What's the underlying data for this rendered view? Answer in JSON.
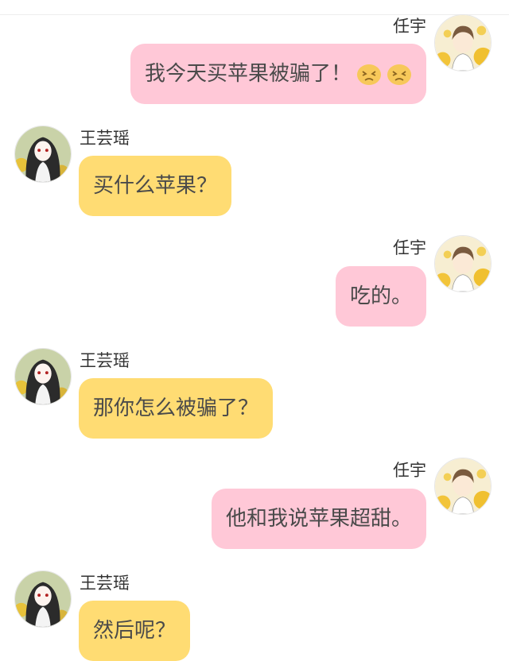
{
  "conversation": {
    "messages": [
      {
        "side": "right",
        "sender": "任宇",
        "text": "我今天买苹果被骗了！",
        "emojis": [
          "crying-face",
          "crying-face"
        ],
        "bubble_color": "#ffc8d7"
      },
      {
        "side": "left",
        "sender": "王芸瑶",
        "text": "买什么苹果？",
        "bubble_color": "#ffdc73"
      },
      {
        "side": "right",
        "sender": "任宇",
        "text": "吃的。",
        "bubble_color": "#ffc8d7"
      },
      {
        "side": "left",
        "sender": "王芸瑶",
        "text": "那你怎么被骗了？",
        "bubble_color": "#ffdc73"
      },
      {
        "side": "right",
        "sender": "任宇",
        "text": "他和我说苹果超甜。",
        "bubble_color": "#ffc8d7"
      },
      {
        "side": "left",
        "sender": "王芸瑶",
        "text": "然后呢？",
        "bubble_color": "#ffdc73"
      }
    ]
  }
}
